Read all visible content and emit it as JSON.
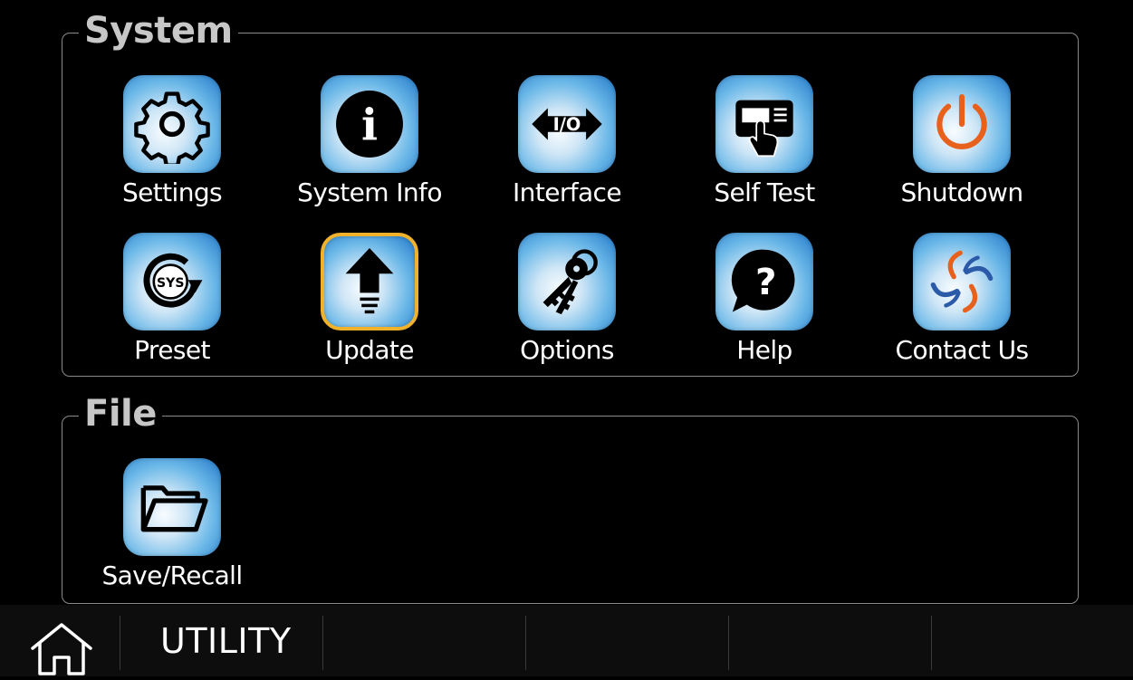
{
  "groups": {
    "system": {
      "title": "System",
      "items": [
        {
          "label": "Settings",
          "icon": "gear-icon"
        },
        {
          "label": "System Info",
          "icon": "info-icon"
        },
        {
          "label": "Interface",
          "icon": "io-icon"
        },
        {
          "label": "Self Test",
          "icon": "self-test-icon"
        },
        {
          "label": "Shutdown",
          "icon": "power-icon"
        },
        {
          "label": "Preset",
          "icon": "sys-preset-icon"
        },
        {
          "label": "Update",
          "icon": "upload-arrow-icon"
        },
        {
          "label": "Options",
          "icon": "keys-icon"
        },
        {
          "label": "Help",
          "icon": "question-bubble-icon"
        },
        {
          "label": "Contact Us",
          "icon": "company-logo-icon"
        }
      ]
    },
    "file": {
      "title": "File",
      "items": [
        {
          "label": "Save/Recall",
          "icon": "folder-icon"
        }
      ]
    }
  },
  "selected_item": "Update",
  "colors": {
    "background": "#000000",
    "selected_border": "#f0b22a",
    "tile_gradient_start": "#f8fcff",
    "tile_gradient_end": "#2178c8",
    "power_icon": "#e8611c"
  },
  "bottom_bar": {
    "home_icon": "home-icon",
    "title": "UTILITY"
  }
}
